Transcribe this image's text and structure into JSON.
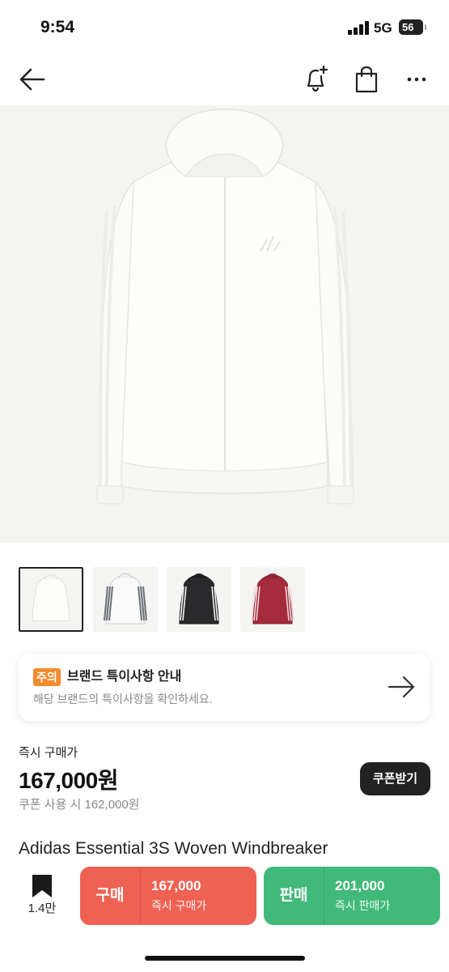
{
  "status_bar": {
    "time": "9:54",
    "network": "5G",
    "battery": "56"
  },
  "nav": {
    "back_icon": "arrow-left-icon",
    "alert_icon": "bell-plus-icon",
    "bag_icon": "shopping-bag-icon",
    "more_icon": "more-horizontal-icon"
  },
  "gallery": {
    "thumbnails": [
      {
        "color": "white",
        "selected": true
      },
      {
        "color": "white-grey",
        "selected": false
      },
      {
        "color": "black",
        "selected": false
      },
      {
        "color": "burgundy",
        "selected": false
      }
    ]
  },
  "notice": {
    "badge": "주의",
    "title": "브랜드 특이사항 안내",
    "subtitle": "해당 브랜드의 특이사항을 확인하세요."
  },
  "price": {
    "label": "즉시 구매가",
    "value": "167,000원",
    "coupon_price": "쿠폰 사용 시 162,000원",
    "coupon_button": "쿠폰받기"
  },
  "product": {
    "name": "Adidas Essential 3S Woven Windbreaker"
  },
  "bottom_bar": {
    "bookmark_count": "1.4만",
    "buy": {
      "label": "구매",
      "price": "167,000",
      "sub": "즉시 구매가"
    },
    "sell": {
      "label": "판매",
      "price": "201,000",
      "sub": "즉시 판매가"
    }
  },
  "colors": {
    "buy": "#ef6253",
    "sell": "#41b979",
    "notice_badge": "#f48a2c",
    "coupon_button": "#222222"
  }
}
